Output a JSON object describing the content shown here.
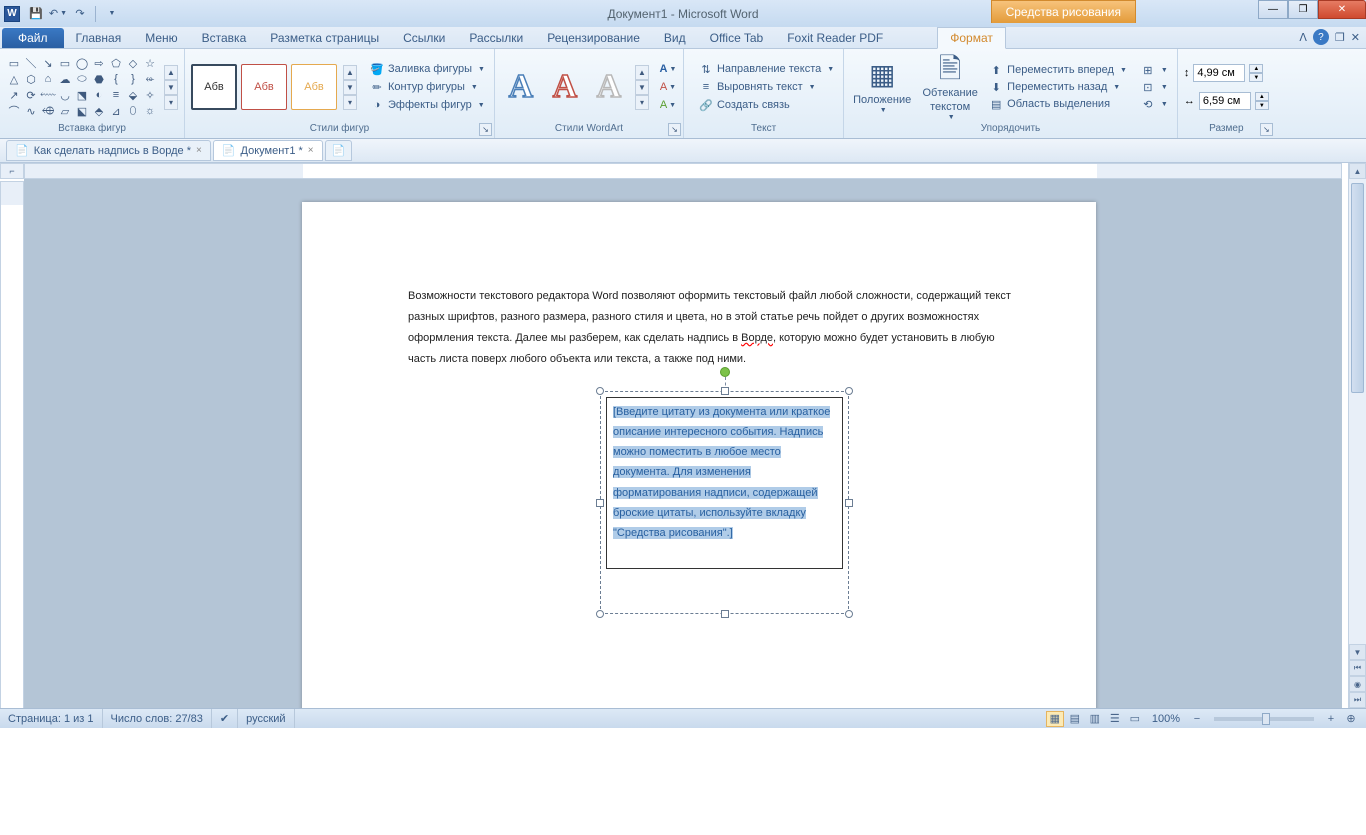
{
  "title": "Документ1  -  Microsoft Word",
  "context_tab": "Средства рисования",
  "tabs": {
    "file": "Файл",
    "items": [
      "Главная",
      "Меню",
      "Вставка",
      "Разметка страницы",
      "Ссылки",
      "Рассылки",
      "Рецензирование",
      "Вид",
      "Office Tab",
      "Foxit Reader PDF"
    ],
    "format": "Формат"
  },
  "groups": {
    "shapes": "Вставка фигур",
    "shape_styles": "Стили фигур",
    "wordart": "Стили WordArt",
    "text": "Текст",
    "arrange": "Упорядочить",
    "size": "Размер"
  },
  "abv": "Абв",
  "shape_opts": {
    "fill": "Заливка фигуры",
    "outline": "Контур фигуры",
    "effects": "Эффекты фигур"
  },
  "text_opts": {
    "dir": "Направление текста",
    "align": "Выровнять текст",
    "link": "Создать связь"
  },
  "pos": "Положение",
  "wrap": "Обтекание текстом",
  "arrange_opts": {
    "fwd": "Переместить вперед",
    "back": "Переместить назад",
    "pane": "Область выделения"
  },
  "size": {
    "h": "4,99 см",
    "w": "6,59 см"
  },
  "doc_tabs": {
    "t1": "Как сделать надпись в Ворде *",
    "t2": "Документ1 *"
  },
  "body_p": "Возможности текстового редактора Word позволяют оформить текстовый файл любой сложности, содержащий текст разных шрифтов, разного размера, разного стиля и цвета, но в этой статье речь пойдет о других возможностях оформления текста. Далее мы разберем, как сделать надпись в ",
  "body_link": "Ворде",
  "body_p2": ", которую можно будет установить в любую часть листа поверх любого объекта или текста, а также под ними.",
  "textbox_content": "[Введите цитату из документа или краткое описание интересного события. Надпись можно поместить в любое место документа. Для изменения форматирования надписи, содержащей броские цитаты, используйте вкладку \"Средства рисования\".]",
  "status": {
    "page": "Страница: 1 из 1",
    "words": "Число слов: 27/83",
    "lang": "русский",
    "zoom": "100%"
  }
}
